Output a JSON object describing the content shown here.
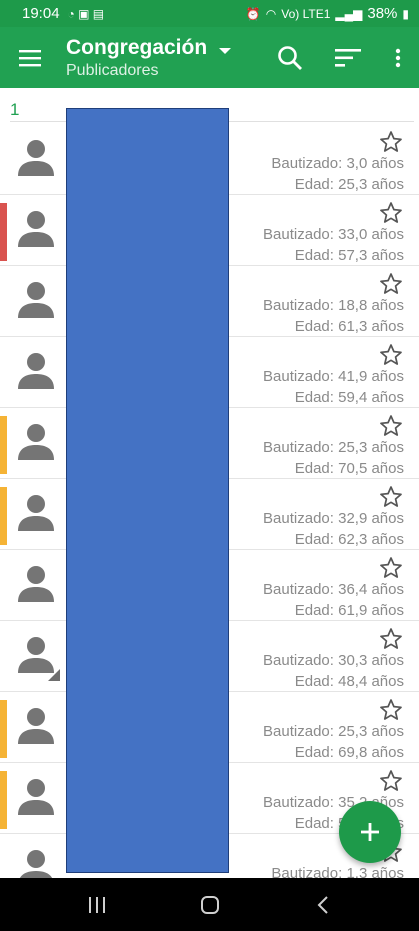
{
  "status_bar": {
    "time": "19:04",
    "battery": "38%",
    "network": "Vo) LTE1"
  },
  "app_bar": {
    "title": "Congregación",
    "subtitle": "Publicadores",
    "icons": [
      "menu-icon",
      "search-icon",
      "sort-icon",
      "more-vert-icon"
    ]
  },
  "section": {
    "label": "1"
  },
  "publishers": [
    {
      "bautizado": "Bautizado: 3,0 años",
      "edad": "Edad: 25,3 años",
      "stripe": ""
    },
    {
      "bautizado": "Bautizado: 33,0 años",
      "edad": "Edad: 57,3 años",
      "stripe": "#d9534f"
    },
    {
      "bautizado": "Bautizado: 18,8 años",
      "edad": "Edad: 61,3 años",
      "stripe": ""
    },
    {
      "bautizado": "Bautizado: 41,9 años",
      "edad": "Edad: 59,4 años",
      "stripe": ""
    },
    {
      "bautizado": "Bautizado: 25,3 años",
      "edad": "Edad: 70,5 años",
      "stripe": "#f5b335"
    },
    {
      "bautizado": "Bautizado: 32,9 años",
      "edad": "Edad: 62,3 años",
      "stripe": "#f5b335"
    },
    {
      "bautizado": "Bautizado: 36,4 años",
      "edad": "Edad: 61,9 años",
      "stripe": ""
    },
    {
      "bautizado": "Bautizado: 30,3 años",
      "edad": "Edad: 48,4 años",
      "stripe": "",
      "corner": true
    },
    {
      "bautizado": "Bautizado: 25,3 años",
      "edad": "Edad: 69,8 años",
      "stripe": "#f5b335"
    },
    {
      "bautizado": "Bautizado: 35,2 años",
      "edad": "Edad: 58,1 años",
      "stripe": "#f5b335"
    },
    {
      "bautizado": "Bautizado: 1,3 años",
      "edad": "",
      "stripe": ""
    }
  ],
  "colors": {
    "app_bar": "#21a152",
    "status_bar": "#1e9a4a",
    "redaction": "#4472c4"
  }
}
